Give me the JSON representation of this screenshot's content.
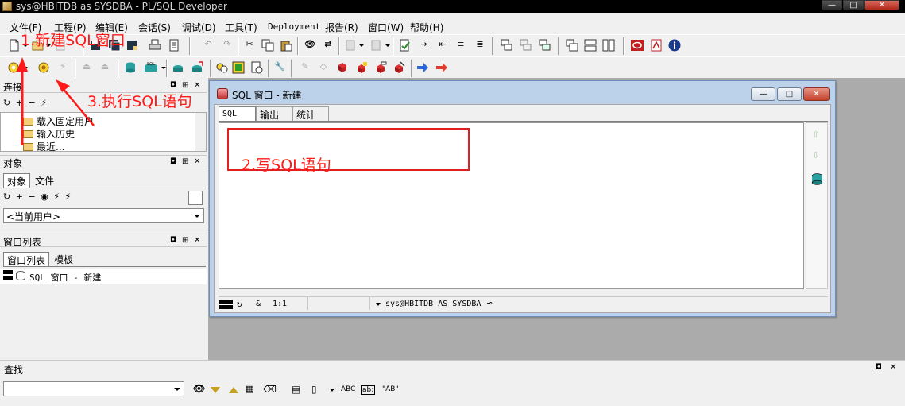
{
  "window": {
    "title": "sys@HBITDB as SYSDBA - PL/SQL Developer",
    "min": "—",
    "max": "□",
    "close": "✕"
  },
  "menu": [
    "文件(F)",
    "工程(P)",
    "编辑(E)",
    "会话(S)",
    "调试(D)",
    "工具(T)",
    "Deployment",
    "报告(R)",
    "窗口(W)",
    "帮助(H)"
  ],
  "connections": {
    "title": "连接",
    "items": [
      "载入固定用户",
      "输入历史",
      "最近..."
    ]
  },
  "objects": {
    "title": "对象",
    "tabs": [
      "对象",
      "文件"
    ],
    "user_select": "<当前用户>"
  },
  "windowlist": {
    "title": "窗口列表",
    "tabs": [
      "窗口列表",
      "模板"
    ],
    "item": "SQL 窗口 - 新建"
  },
  "panel_controls": {
    "dock": "◘",
    "close": "✕"
  },
  "sql_window": {
    "title": "SQL 窗口 - 新建",
    "tabs": [
      "SQL",
      "输出",
      "统计"
    ],
    "editor_text": "",
    "status": {
      "amp": "&",
      "position": "1:1",
      "connection": "sys@HBITDB AS SYSDBA"
    },
    "buttons": {
      "min": "—",
      "max": "□",
      "close": "✕"
    }
  },
  "search": {
    "title": "查找",
    "value": "",
    "opts": [
      "ABC",
      "ab:",
      "\"AB\""
    ]
  },
  "annotations": {
    "step1": "1.新建SQL窗口",
    "step2": "2.写SQL语句",
    "step3": "3.执行SQL语句"
  },
  "colors": {
    "annotation_red": "#ff1a1a",
    "mdi_background": "#ababab",
    "window_frame": "#bcd2ea"
  }
}
